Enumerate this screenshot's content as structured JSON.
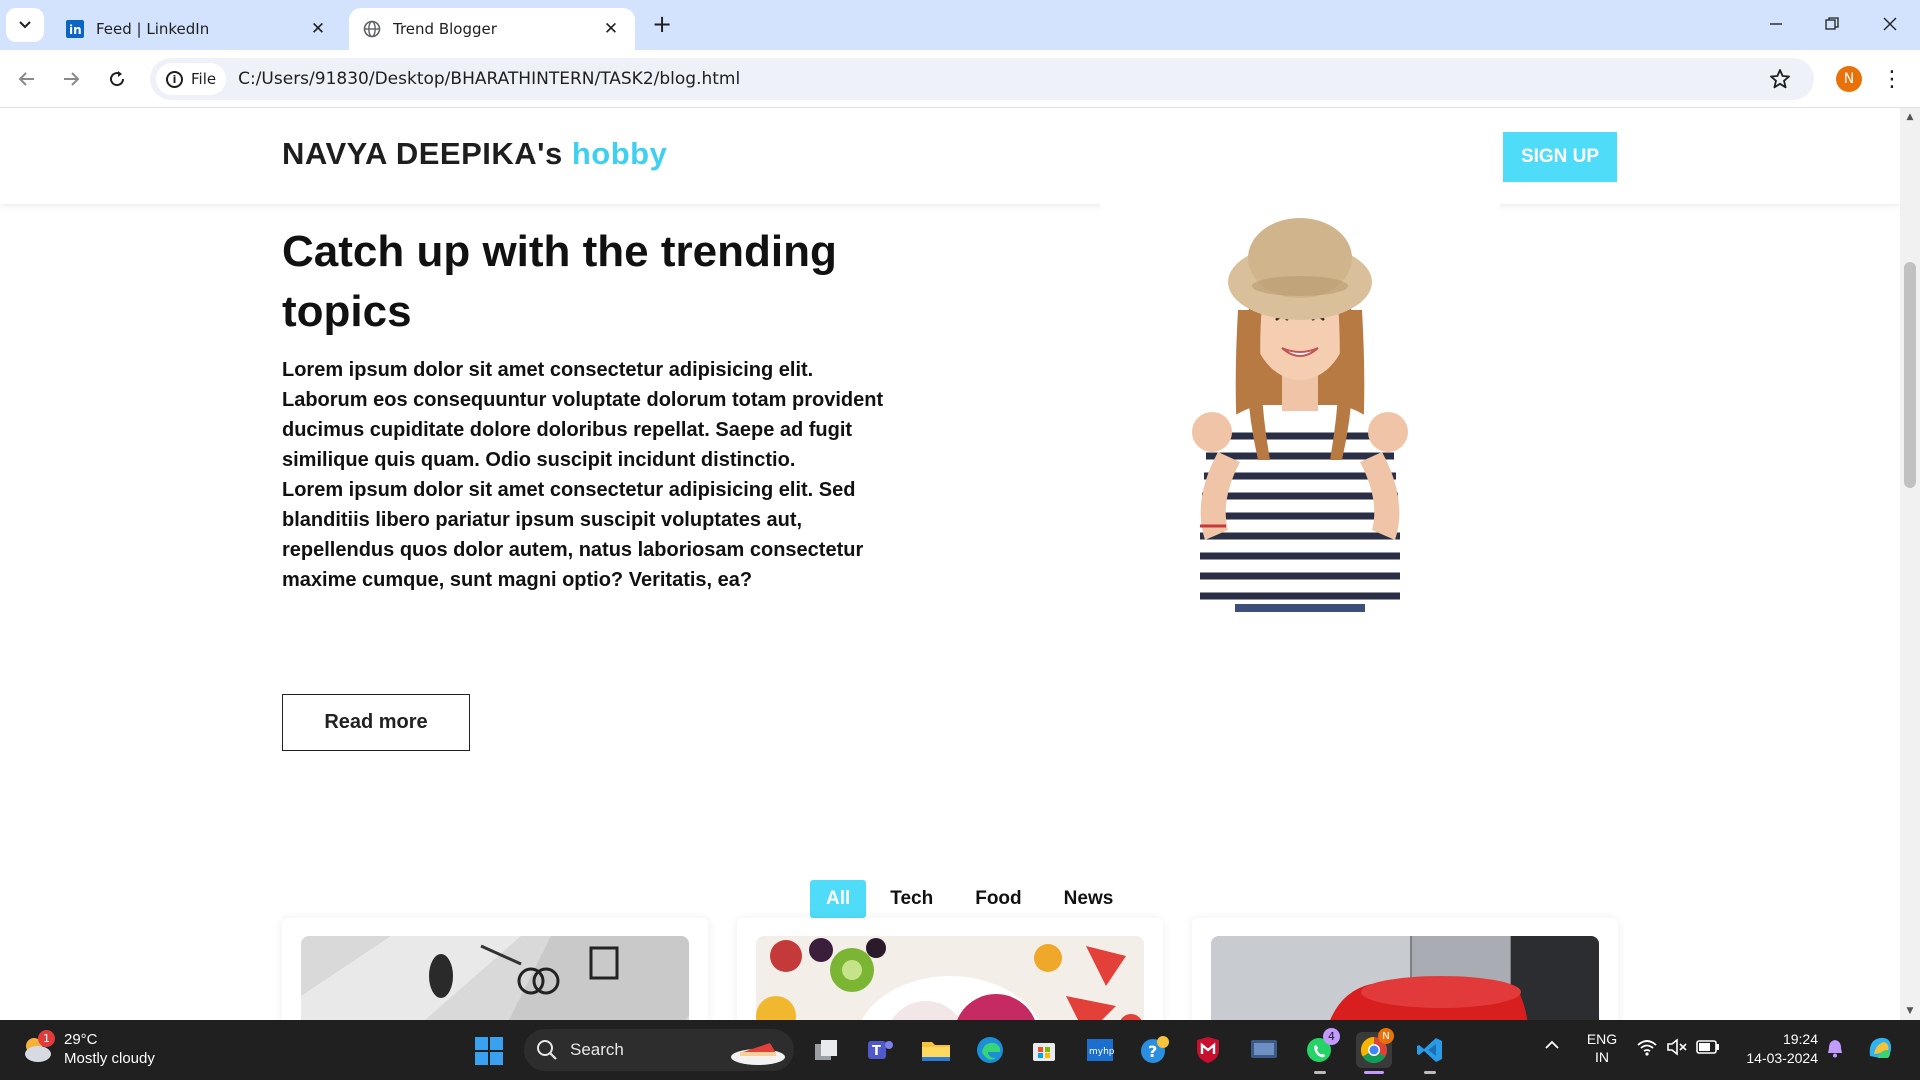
{
  "browser": {
    "tabs": [
      {
        "title": "Feed | LinkedIn",
        "active": false,
        "favicon": "linkedin-icon"
      },
      {
        "title": "Trend Blogger",
        "active": true,
        "favicon": "globe-icon"
      }
    ],
    "address": {
      "scheme_chip": "File",
      "url": "C:/Users/91830/Desktop/BHARATHINTERN/TASK2/blog.html"
    },
    "profile_initial": "N",
    "profile_color": "#e8710a"
  },
  "site": {
    "brand_name": "NAVYA DEEPIKA's",
    "brand_accent": "hobby",
    "accent_color": "#4fdcf8",
    "signup_label": "SIGN UP",
    "hero": {
      "title": "Catch up with the trending topics",
      "paragraph1": "Lorem ipsum dolor sit amet consectetur adipisicing elit. Laborum eos consequuntur voluptate dolorum totam provident ducimus cupiditate dolore doloribus repellat. Saepe ad fugit similique quis quam. Odio suscipit incidunt distinctio.",
      "paragraph2": "Lorem ipsum dolor sit amet consectetur adipisicing elit. Sed blanditiis libero pariatur ipsum suscipit voluptates aut, repellendus quos dolor autem, natus laboriosam consectetur maxime cumque, sunt magni optio? Veritatis, ea?",
      "read_more_label": "Read more"
    },
    "filters": [
      {
        "label": "All",
        "active": true
      },
      {
        "label": "Tech",
        "active": false
      },
      {
        "label": "Food",
        "active": false
      },
      {
        "label": "News",
        "active": false
      }
    ]
  },
  "taskbar": {
    "weather": {
      "temp": "29°C",
      "desc": "Mostly cloudy",
      "badge": "1"
    },
    "search_label": "Search",
    "whatsapp_badge": "4",
    "chrome_badge": "N",
    "language": {
      "line1": "ENG",
      "line2": "IN"
    },
    "clock": {
      "time": "19:24",
      "date": "14-03-2024"
    }
  }
}
